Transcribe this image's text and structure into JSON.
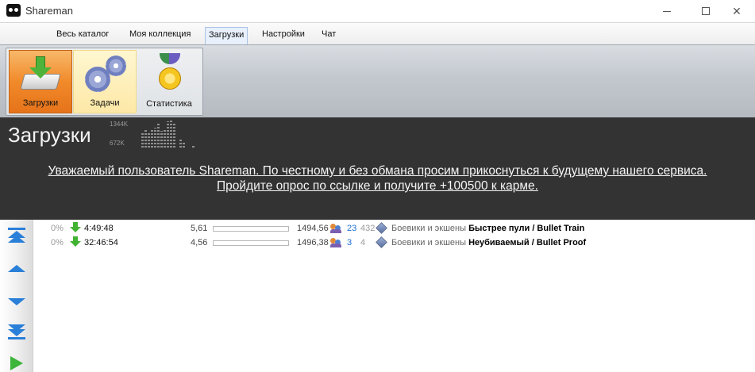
{
  "window": {
    "title": "Shareman"
  },
  "menu": {
    "tabs": [
      {
        "label": "Весь каталог"
      },
      {
        "label": "Моя коллекция"
      },
      {
        "label": "Загрузки"
      },
      {
        "label": "Настройки"
      },
      {
        "label": "Чат"
      }
    ],
    "active_tab": "Загрузки"
  },
  "ribbon": {
    "buttons": [
      {
        "label": "Загрузки",
        "icon": "download-icon",
        "state": "active"
      },
      {
        "label": "Задачи",
        "icon": "gears-icon",
        "state": "hover"
      },
      {
        "label": "Статистика",
        "icon": "medal-icon",
        "state": "normal"
      }
    ]
  },
  "header": {
    "title": "Загрузки",
    "speed_max": "1344K",
    "speed_mid": "672K",
    "speed_levels": [
      0.0,
      0.0,
      0.52,
      0.6,
      0.55,
      0.62,
      0.7,
      0.82,
      0.58,
      0.68,
      0.92,
      0.96,
      0.88,
      0.0,
      0.34,
      0.22,
      0.0,
      0.0,
      0.05
    ],
    "banner_line1": "Уважаемый пользователь Shareman. По честному и без обмана просим прикоснуться к будущему нашего сервиса.",
    "banner_line2": "Пройдите опрос по ссылке и получите +100500 к карме."
  },
  "nav_icons": [
    "scroll-top-icon",
    "scroll-up-icon",
    "scroll-down-icon",
    "scroll-bottom-icon",
    "start-icon"
  ],
  "colors": {
    "accent_orange": "#f18a2a",
    "nav_blue": "#2a7fd8",
    "download_green": "#42b233",
    "header_dark": "#333333"
  },
  "downloads": [
    {
      "percent": "0%",
      "time_left": "4:49:48",
      "speed": "5,61",
      "progress": 0.0,
      "size": "1494,56",
      "seeds": "23",
      "peers": "432",
      "category": "Боевики и экшены",
      "title": "Быстрее пули / Bullet Train"
    },
    {
      "percent": "0%",
      "time_left": "32:46:54",
      "speed": "4,56",
      "progress": 0.0,
      "size": "1496,38",
      "seeds": "3",
      "peers": "4",
      "category": "Боевики и экшены",
      "title": "Неубиваемый / Bullet Proof"
    }
  ]
}
